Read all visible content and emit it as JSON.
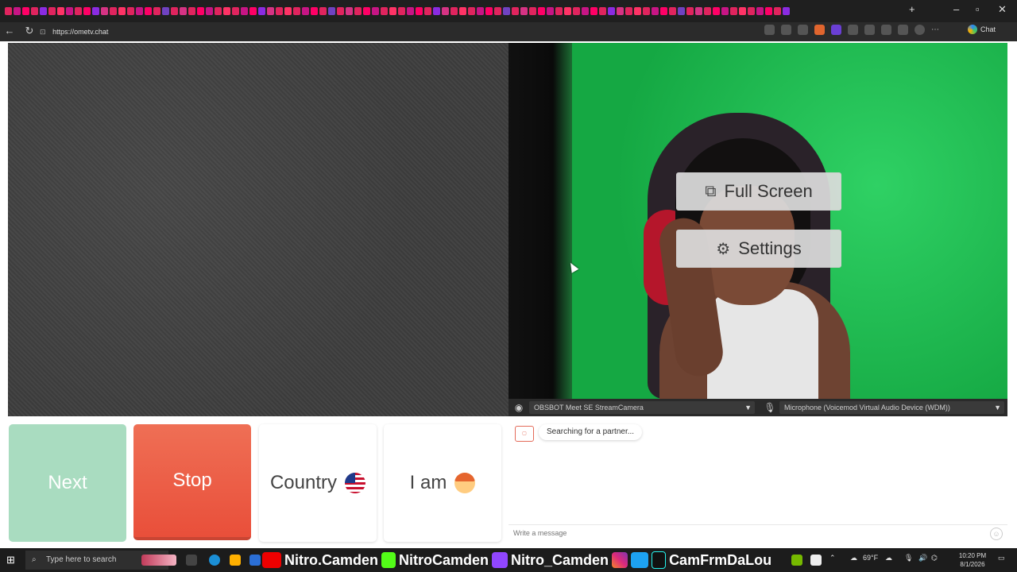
{
  "browser": {
    "url": "https://ometv.chat",
    "chat_label": "Chat",
    "tab_colors": [
      "#e0245e",
      "#c71585",
      "#ff0066",
      "#e0245e",
      "#8a2be2",
      "#e0245e",
      "#ff3366",
      "#c71585",
      "#e0245e",
      "#ff0066",
      "#8a2be2",
      "#d63384",
      "#e0245e",
      "#ff3366",
      "#e0245e",
      "#c71585",
      "#ff0066",
      "#e0245e",
      "#6f42c1",
      "#e0245e",
      "#d63384",
      "#e0245e",
      "#ff0066",
      "#c71585",
      "#e0245e",
      "#ff3366",
      "#e0245e",
      "#c71585",
      "#ff0066",
      "#8a2be2",
      "#d63384",
      "#e0245e",
      "#ff3366",
      "#e0245e",
      "#c71585",
      "#ff0066",
      "#e0245e",
      "#6f42c1",
      "#e0245e",
      "#d63384",
      "#e0245e",
      "#ff0066",
      "#c71585",
      "#e0245e",
      "#ff3366",
      "#e0245e",
      "#c71585",
      "#ff0066",
      "#e0245e",
      "#8a2be2",
      "#d63384",
      "#e0245e",
      "#ff3366",
      "#e0245e",
      "#c71585",
      "#ff0066",
      "#e0245e",
      "#6f42c1",
      "#e0245e",
      "#d63384",
      "#e0245e",
      "#ff0066",
      "#c71585",
      "#e0245e",
      "#ff3366",
      "#e0245e",
      "#c71585",
      "#ff0066",
      "#e0245e",
      "#8a2be2",
      "#d63384",
      "#e0245e",
      "#ff3366",
      "#e0245e",
      "#c71585",
      "#ff0066",
      "#e0245e",
      "#6f42c1",
      "#e0245e",
      "#d63384",
      "#e0245e",
      "#ff0066",
      "#c71585",
      "#e0245e",
      "#ff3366",
      "#e0245e",
      "#c71585",
      "#ff0066",
      "#e0245e",
      "#8a2be2"
    ]
  },
  "overlay": {
    "fullscreen_label": "Full Screen",
    "settings_label": "Settings"
  },
  "devices": {
    "camera": "OBSBOT Meet SE StreamCamera",
    "microphone": "Microphone (Voicemod Virtual Audio Device (WDM))"
  },
  "controls": {
    "next_label": "Next",
    "stop_label": "Stop",
    "country_label": "Country",
    "iam_label": "I am"
  },
  "chat": {
    "status": "Searching for a partner...",
    "placeholder": "Write a message"
  },
  "taskbar": {
    "search_placeholder": "Type here to search",
    "social_youtube": "Nitro.Camden",
    "social_kick": "NitroCamden",
    "social_twitch": "Nitro_Camden",
    "social_other": "CamFrmDaLou",
    "weather": "69°F",
    "time": "10:20 PM",
    "date": "8/1/2026"
  }
}
